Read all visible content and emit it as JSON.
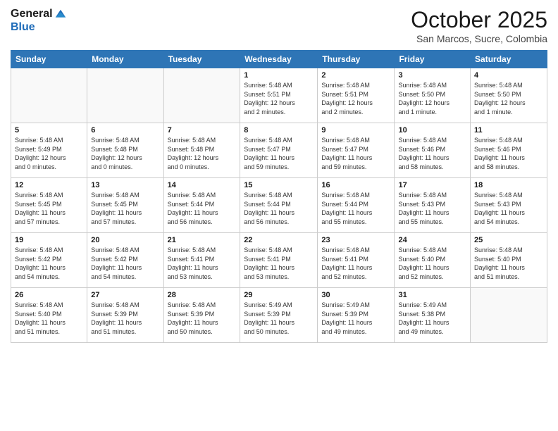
{
  "logo": {
    "general": "General",
    "blue": "Blue"
  },
  "header": {
    "month": "October 2025",
    "location": "San Marcos, Sucre, Colombia"
  },
  "weekdays": [
    "Sunday",
    "Monday",
    "Tuesday",
    "Wednesday",
    "Thursday",
    "Friday",
    "Saturday"
  ],
  "weeks": [
    [
      {
        "day": "",
        "info": ""
      },
      {
        "day": "",
        "info": ""
      },
      {
        "day": "",
        "info": ""
      },
      {
        "day": "1",
        "info": "Sunrise: 5:48 AM\nSunset: 5:51 PM\nDaylight: 12 hours\nand 2 minutes."
      },
      {
        "day": "2",
        "info": "Sunrise: 5:48 AM\nSunset: 5:51 PM\nDaylight: 12 hours\nand 2 minutes."
      },
      {
        "day": "3",
        "info": "Sunrise: 5:48 AM\nSunset: 5:50 PM\nDaylight: 12 hours\nand 1 minute."
      },
      {
        "day": "4",
        "info": "Sunrise: 5:48 AM\nSunset: 5:50 PM\nDaylight: 12 hours\nand 1 minute."
      }
    ],
    [
      {
        "day": "5",
        "info": "Sunrise: 5:48 AM\nSunset: 5:49 PM\nDaylight: 12 hours\nand 0 minutes."
      },
      {
        "day": "6",
        "info": "Sunrise: 5:48 AM\nSunset: 5:48 PM\nDaylight: 12 hours\nand 0 minutes."
      },
      {
        "day": "7",
        "info": "Sunrise: 5:48 AM\nSunset: 5:48 PM\nDaylight: 12 hours\nand 0 minutes."
      },
      {
        "day": "8",
        "info": "Sunrise: 5:48 AM\nSunset: 5:47 PM\nDaylight: 11 hours\nand 59 minutes."
      },
      {
        "day": "9",
        "info": "Sunrise: 5:48 AM\nSunset: 5:47 PM\nDaylight: 11 hours\nand 59 minutes."
      },
      {
        "day": "10",
        "info": "Sunrise: 5:48 AM\nSunset: 5:46 PM\nDaylight: 11 hours\nand 58 minutes."
      },
      {
        "day": "11",
        "info": "Sunrise: 5:48 AM\nSunset: 5:46 PM\nDaylight: 11 hours\nand 58 minutes."
      }
    ],
    [
      {
        "day": "12",
        "info": "Sunrise: 5:48 AM\nSunset: 5:45 PM\nDaylight: 11 hours\nand 57 minutes."
      },
      {
        "day": "13",
        "info": "Sunrise: 5:48 AM\nSunset: 5:45 PM\nDaylight: 11 hours\nand 57 minutes."
      },
      {
        "day": "14",
        "info": "Sunrise: 5:48 AM\nSunset: 5:44 PM\nDaylight: 11 hours\nand 56 minutes."
      },
      {
        "day": "15",
        "info": "Sunrise: 5:48 AM\nSunset: 5:44 PM\nDaylight: 11 hours\nand 56 minutes."
      },
      {
        "day": "16",
        "info": "Sunrise: 5:48 AM\nSunset: 5:44 PM\nDaylight: 11 hours\nand 55 minutes."
      },
      {
        "day": "17",
        "info": "Sunrise: 5:48 AM\nSunset: 5:43 PM\nDaylight: 11 hours\nand 55 minutes."
      },
      {
        "day": "18",
        "info": "Sunrise: 5:48 AM\nSunset: 5:43 PM\nDaylight: 11 hours\nand 54 minutes."
      }
    ],
    [
      {
        "day": "19",
        "info": "Sunrise: 5:48 AM\nSunset: 5:42 PM\nDaylight: 11 hours\nand 54 minutes."
      },
      {
        "day": "20",
        "info": "Sunrise: 5:48 AM\nSunset: 5:42 PM\nDaylight: 11 hours\nand 54 minutes."
      },
      {
        "day": "21",
        "info": "Sunrise: 5:48 AM\nSunset: 5:41 PM\nDaylight: 11 hours\nand 53 minutes."
      },
      {
        "day": "22",
        "info": "Sunrise: 5:48 AM\nSunset: 5:41 PM\nDaylight: 11 hours\nand 53 minutes."
      },
      {
        "day": "23",
        "info": "Sunrise: 5:48 AM\nSunset: 5:41 PM\nDaylight: 11 hours\nand 52 minutes."
      },
      {
        "day": "24",
        "info": "Sunrise: 5:48 AM\nSunset: 5:40 PM\nDaylight: 11 hours\nand 52 minutes."
      },
      {
        "day": "25",
        "info": "Sunrise: 5:48 AM\nSunset: 5:40 PM\nDaylight: 11 hours\nand 51 minutes."
      }
    ],
    [
      {
        "day": "26",
        "info": "Sunrise: 5:48 AM\nSunset: 5:40 PM\nDaylight: 11 hours\nand 51 minutes."
      },
      {
        "day": "27",
        "info": "Sunrise: 5:48 AM\nSunset: 5:39 PM\nDaylight: 11 hours\nand 51 minutes."
      },
      {
        "day": "28",
        "info": "Sunrise: 5:48 AM\nSunset: 5:39 PM\nDaylight: 11 hours\nand 50 minutes."
      },
      {
        "day": "29",
        "info": "Sunrise: 5:49 AM\nSunset: 5:39 PM\nDaylight: 11 hours\nand 50 minutes."
      },
      {
        "day": "30",
        "info": "Sunrise: 5:49 AM\nSunset: 5:39 PM\nDaylight: 11 hours\nand 49 minutes."
      },
      {
        "day": "31",
        "info": "Sunrise: 5:49 AM\nSunset: 5:38 PM\nDaylight: 11 hours\nand 49 minutes."
      },
      {
        "day": "",
        "info": ""
      }
    ]
  ]
}
